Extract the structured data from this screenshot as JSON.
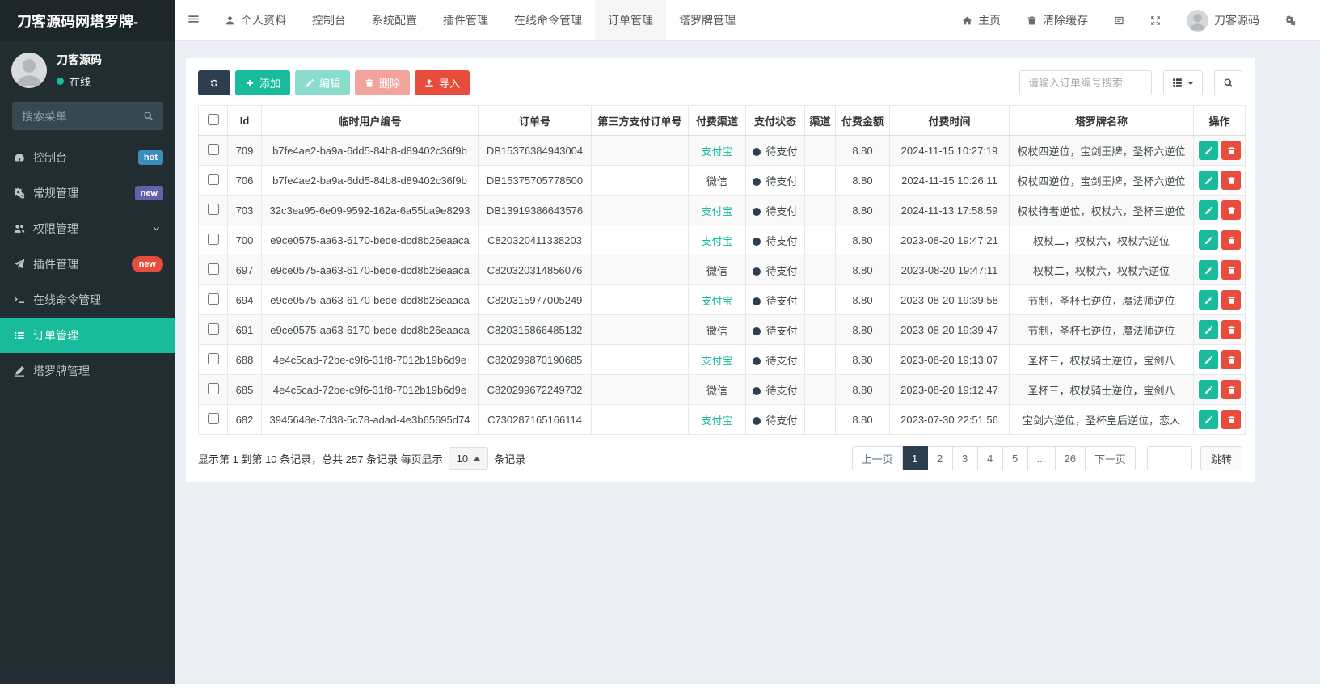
{
  "sidebar": {
    "logo": "刀客源码网塔罗牌-",
    "user": {
      "name": "刀客源码",
      "status": "在线"
    },
    "search_placeholder": "搜索菜单",
    "menu": [
      {
        "key": "dashboard",
        "label": "控制台",
        "icon": "dashboard-icon",
        "badge": "hot",
        "badge_style": "blue"
      },
      {
        "key": "general",
        "label": "常规管理",
        "icon": "cogs-icon",
        "badge": "new",
        "badge_style": "purple"
      },
      {
        "key": "permissions",
        "label": "权限管理",
        "icon": "users-icon",
        "chevron": true
      },
      {
        "key": "plugins",
        "label": "插件管理",
        "icon": "paper-plane-icon",
        "badge": "new",
        "badge_style": "red-pill"
      },
      {
        "key": "online-command",
        "label": "在线命令管理",
        "icon": "terminal-icon"
      },
      {
        "key": "orders",
        "label": "订单管理",
        "icon": "list-icon",
        "active": true
      },
      {
        "key": "tarot",
        "label": "塔罗牌管理",
        "icon": "signature-icon"
      }
    ]
  },
  "topnav": {
    "items": [
      {
        "key": "profile",
        "label": "个人资料",
        "icon": "user-icon"
      },
      {
        "key": "console",
        "label": "控制台"
      },
      {
        "key": "system-config",
        "label": "系统配置"
      },
      {
        "key": "plugin-management",
        "label": "插件管理"
      },
      {
        "key": "online-command",
        "label": "在线命令管理"
      },
      {
        "key": "order-management",
        "label": "订单管理",
        "active": true
      },
      {
        "key": "tarot-management",
        "label": "塔罗牌管理"
      }
    ],
    "home_label": "主页",
    "clear_cache_label": "清除缓存",
    "user_name": "刀客源码"
  },
  "toolbar": {
    "add_label": "添加",
    "edit_label": "编辑",
    "delete_label": "删除",
    "import_label": "导入",
    "search_placeholder": "请输入订单编号搜索"
  },
  "table": {
    "columns": [
      "Id",
      "临时用户编号",
      "订单号",
      "第三方支付订单号",
      "付费渠道",
      "支付状态",
      "渠道",
      "付费金额",
      "付费时间",
      "塔罗牌名称",
      "操作"
    ],
    "rows": [
      {
        "id": "709",
        "user_id": "b7fe4ae2-ba9a-6dd5-84b8-d89402c36f9b",
        "order_no": "DB15376384943004",
        "third_party_no": "",
        "pay_channel": "支付宝",
        "pay_channel_link": true,
        "pay_status": "待支付",
        "channel": "",
        "amount": "8.80",
        "pay_time": "2024-11-15 10:27:19",
        "tarot_cards": "权杖四逆位，宝剑王牌，圣杯六逆位"
      },
      {
        "id": "706",
        "user_id": "b7fe4ae2-ba9a-6dd5-84b8-d89402c36f9b",
        "order_no": "DB15375705778500",
        "third_party_no": "",
        "pay_channel": "微信",
        "pay_channel_link": false,
        "pay_status": "待支付",
        "channel": "",
        "amount": "8.80",
        "pay_time": "2024-11-15 10:26:11",
        "tarot_cards": "权杖四逆位，宝剑王牌，圣杯六逆位"
      },
      {
        "id": "703",
        "user_id": "32c3ea95-6e09-9592-162a-6a55ba9e8293",
        "order_no": "DB13919386643576",
        "third_party_no": "",
        "pay_channel": "支付宝",
        "pay_channel_link": true,
        "pay_status": "待支付",
        "channel": "",
        "amount": "8.80",
        "pay_time": "2024-11-13 17:58:59",
        "tarot_cards": "权杖待者逆位，权杖六，圣杯三逆位"
      },
      {
        "id": "700",
        "user_id": "e9ce0575-aa63-6170-bede-dcd8b26eaaca",
        "order_no": "C820320411338203",
        "third_party_no": "",
        "pay_channel": "支付宝",
        "pay_channel_link": true,
        "pay_status": "待支付",
        "channel": "",
        "amount": "8.80",
        "pay_time": "2023-08-20 19:47:21",
        "tarot_cards": "权杖二，权杖六，权杖六逆位"
      },
      {
        "id": "697",
        "user_id": "e9ce0575-aa63-6170-bede-dcd8b26eaaca",
        "order_no": "C820320314856076",
        "third_party_no": "",
        "pay_channel": "微信",
        "pay_channel_link": false,
        "pay_status": "待支付",
        "channel": "",
        "amount": "8.80",
        "pay_time": "2023-08-20 19:47:11",
        "tarot_cards": "权杖二，权杖六，权杖六逆位"
      },
      {
        "id": "694",
        "user_id": "e9ce0575-aa63-6170-bede-dcd8b26eaaca",
        "order_no": "C820315977005249",
        "third_party_no": "",
        "pay_channel": "支付宝",
        "pay_channel_link": true,
        "pay_status": "待支付",
        "channel": "",
        "amount": "8.80",
        "pay_time": "2023-08-20 19:39:58",
        "tarot_cards": "节制，圣杯七逆位，魔法师逆位"
      },
      {
        "id": "691",
        "user_id": "e9ce0575-aa63-6170-bede-dcd8b26eaaca",
        "order_no": "C820315866485132",
        "third_party_no": "",
        "pay_channel": "微信",
        "pay_channel_link": false,
        "pay_status": "待支付",
        "channel": "",
        "amount": "8.80",
        "pay_time": "2023-08-20 19:39:47",
        "tarot_cards": "节制，圣杯七逆位，魔法师逆位"
      },
      {
        "id": "688",
        "user_id": "4e4c5cad-72be-c9f6-31f8-7012b19b6d9e",
        "order_no": "C820299870190685",
        "third_party_no": "",
        "pay_channel": "支付宝",
        "pay_channel_link": true,
        "pay_status": "待支付",
        "channel": "",
        "amount": "8.80",
        "pay_time": "2023-08-20 19:13:07",
        "tarot_cards": "圣杯三，权杖骑士逆位，宝剑八"
      },
      {
        "id": "685",
        "user_id": "4e4c5cad-72be-c9f6-31f8-7012b19b6d9e",
        "order_no": "C820299672249732",
        "third_party_no": "",
        "pay_channel": "微信",
        "pay_channel_link": false,
        "pay_status": "待支付",
        "channel": "",
        "amount": "8.80",
        "pay_time": "2023-08-20 19:12:47",
        "tarot_cards": "圣杯三，权杖骑士逆位，宝剑八"
      },
      {
        "id": "682",
        "user_id": "3945648e-7d38-5c78-adad-4e3b65695d74",
        "order_no": "C730287165166114",
        "third_party_no": "",
        "pay_channel": "支付宝",
        "pay_channel_link": true,
        "pay_status": "待支付",
        "channel": "",
        "amount": "8.80",
        "pay_time": "2023-07-30 22:51:56",
        "tarot_cards": "宝剑六逆位，圣杯皇后逆位，恋人"
      }
    ]
  },
  "pagination": {
    "summary_prefix": "显示第 1 到第 10 条记录，总共 257 条记录 每页显示",
    "page_size": "10",
    "summary_suffix": "条记录",
    "prev_label": "上一页",
    "next_label": "下一页",
    "pages": [
      "1",
      "2",
      "3",
      "4",
      "5",
      "...",
      "26"
    ],
    "active_page": "1",
    "jump_label": "跳转"
  },
  "colors": {
    "accent_teal": "#18bc9c",
    "accent_red": "#e74c3c",
    "dark_navy": "#2c3e50",
    "sidebar_bg": "#222d32",
    "badge_hot_blue": "#3c8dbc",
    "badge_new_purple": "#6560ae"
  }
}
